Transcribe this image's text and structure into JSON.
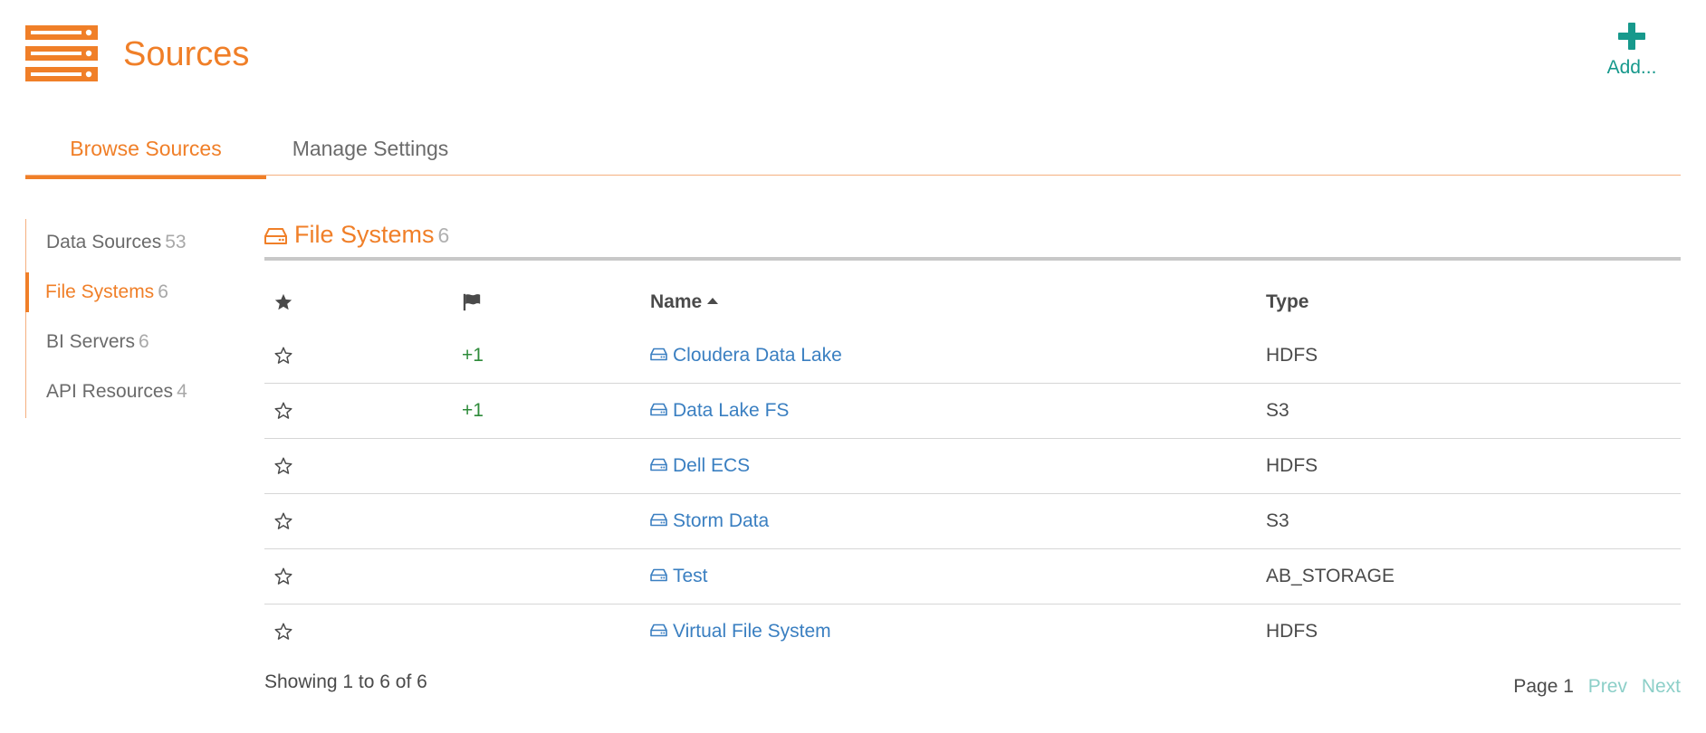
{
  "header": {
    "title": "Sources",
    "add_label": "Add...",
    "logo_icon": "server-stack-icon",
    "accent_color": "#f07f28",
    "add_color": "#17998c"
  },
  "tabs": [
    {
      "label": "Browse Sources",
      "active": true
    },
    {
      "label": "Manage Settings",
      "active": false
    }
  ],
  "sidebar": {
    "items": [
      {
        "label": "Data Sources",
        "count": "53",
        "active": false
      },
      {
        "label": "File Systems",
        "count": "6",
        "active": true
      },
      {
        "label": "BI Servers",
        "count": "6",
        "active": false
      },
      {
        "label": "API Resources",
        "count": "4",
        "active": false
      }
    ]
  },
  "section": {
    "title": "File Systems",
    "count": "6",
    "icon": "hard-drive-icon"
  },
  "table": {
    "columns": {
      "star": "star-icon",
      "flag": "flag-icon",
      "name": "Name",
      "type": "Type"
    },
    "sort": {
      "column": "Name",
      "direction": "ascending"
    },
    "rows": [
      {
        "vote": "+1",
        "name": "Cloudera Data Lake",
        "type": "HDFS"
      },
      {
        "vote": "+1",
        "name": "Data Lake FS",
        "type": "S3"
      },
      {
        "vote": "",
        "name": "Dell ECS",
        "type": "HDFS"
      },
      {
        "vote": "",
        "name": "Storm Data",
        "type": "S3"
      },
      {
        "vote": "",
        "name": "Test",
        "type": "AB_STORAGE"
      },
      {
        "vote": "",
        "name": "Virtual File System",
        "type": "HDFS"
      }
    ]
  },
  "footer": {
    "showing": "Showing 1 to 6 of 6",
    "page_label": "Page 1",
    "prev": "Prev",
    "next": "Next"
  }
}
